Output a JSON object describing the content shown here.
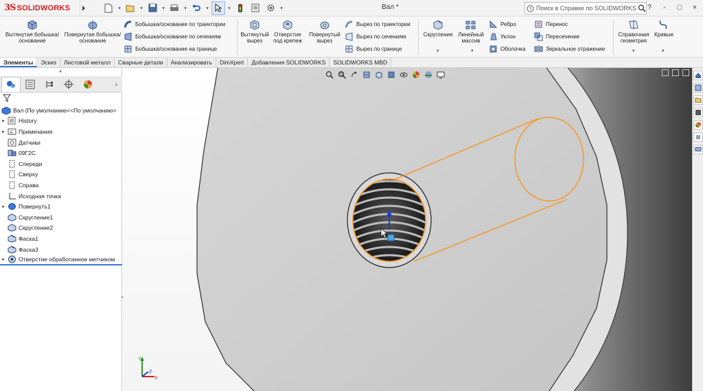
{
  "app": {
    "logo_text": "SOLIDWORKS",
    "logo_prefix": "3S",
    "document_title": "Вал *"
  },
  "help_search": {
    "placeholder": "Поиск в Справке по SOLIDWORKS"
  },
  "window_controls": [
    "?",
    "-",
    "□",
    "×"
  ],
  "command_manager": {
    "extruded_boss": "Вытянутая бобышка/основание",
    "revolved_boss": "Повернутая бобышка/основание",
    "swept_boss": "Бобышка/основание по траектории",
    "lofted_boss": "Бобышка/основание по сечениям",
    "boundary_boss": "Бобышка/основание на границе",
    "extruded_cut": "Вытянутый вырез",
    "hole_wizard": "Отверстие под крепеж",
    "revolved_cut": "Повернутый вырез",
    "swept_cut": "Вырез по траектории",
    "lofted_cut": "Вырез по сечениям",
    "boundary_cut": "Вырез по границе",
    "fillet": "Скругление",
    "linear_pattern": "Линейный массив",
    "rib": "Ребро",
    "draft": "Уклон",
    "shell": "Оболочка",
    "wrap": "Перенос",
    "intersect": "Пересечение",
    "mirror": "Зеркальное отражение",
    "ref_geometry": "Справочная геометрия",
    "curves": "Кривые"
  },
  "tabs": [
    {
      "label": "Элементы",
      "active": true
    },
    {
      "label": "Эскиз",
      "active": false
    },
    {
      "label": "Листовой металл",
      "active": false
    },
    {
      "label": "Сварные детали",
      "active": false
    },
    {
      "label": "Анализировать",
      "active": false
    },
    {
      "label": "DimXpert",
      "active": false
    },
    {
      "label": "Добавления SOLIDWORKS",
      "active": false
    },
    {
      "label": "SOLIDWORKS MBD",
      "active": false
    }
  ],
  "feature_tree": {
    "root": "Вал  (По умолчанию<<По умолчанию>",
    "items": [
      {
        "label": "History",
        "icon": "history-icon",
        "expandable": true
      },
      {
        "label": "Примечания",
        "icon": "annotations-icon",
        "expandable": true
      },
      {
        "label": "Датчики",
        "icon": "sensor-icon",
        "expandable": false
      },
      {
        "label": "09Г2С",
        "icon": "material-icon",
        "expandable": false
      },
      {
        "label": "Спереди",
        "icon": "plane-icon",
        "expandable": false
      },
      {
        "label": "Сверху",
        "icon": "plane-icon",
        "expandable": false
      },
      {
        "label": "Справа",
        "icon": "plane-icon",
        "expandable": false
      },
      {
        "label": "Исходная точка",
        "icon": "origin-icon",
        "expandable": false
      },
      {
        "label": "Повернуть1",
        "icon": "revolve-icon",
        "expandable": true
      },
      {
        "label": "Скругление1",
        "icon": "fillet-icon",
        "expandable": false
      },
      {
        "label": "Скругление2",
        "icon": "fillet-icon",
        "expandable": false
      },
      {
        "label": "Фаска1",
        "icon": "chamfer-icon",
        "expandable": false
      },
      {
        "label": "Фаска3",
        "icon": "chamfer-icon",
        "expandable": false
      },
      {
        "label": "Отверстие обработанное метчиком",
        "icon": "tapped-hole-icon",
        "expandable": true,
        "selected": true
      }
    ]
  },
  "triad": {
    "x": "X",
    "y": "Y",
    "z": "Z"
  },
  "colors": {
    "accent": "#3b78d8",
    "selection": "#f7941d",
    "logo": "#d32020"
  }
}
